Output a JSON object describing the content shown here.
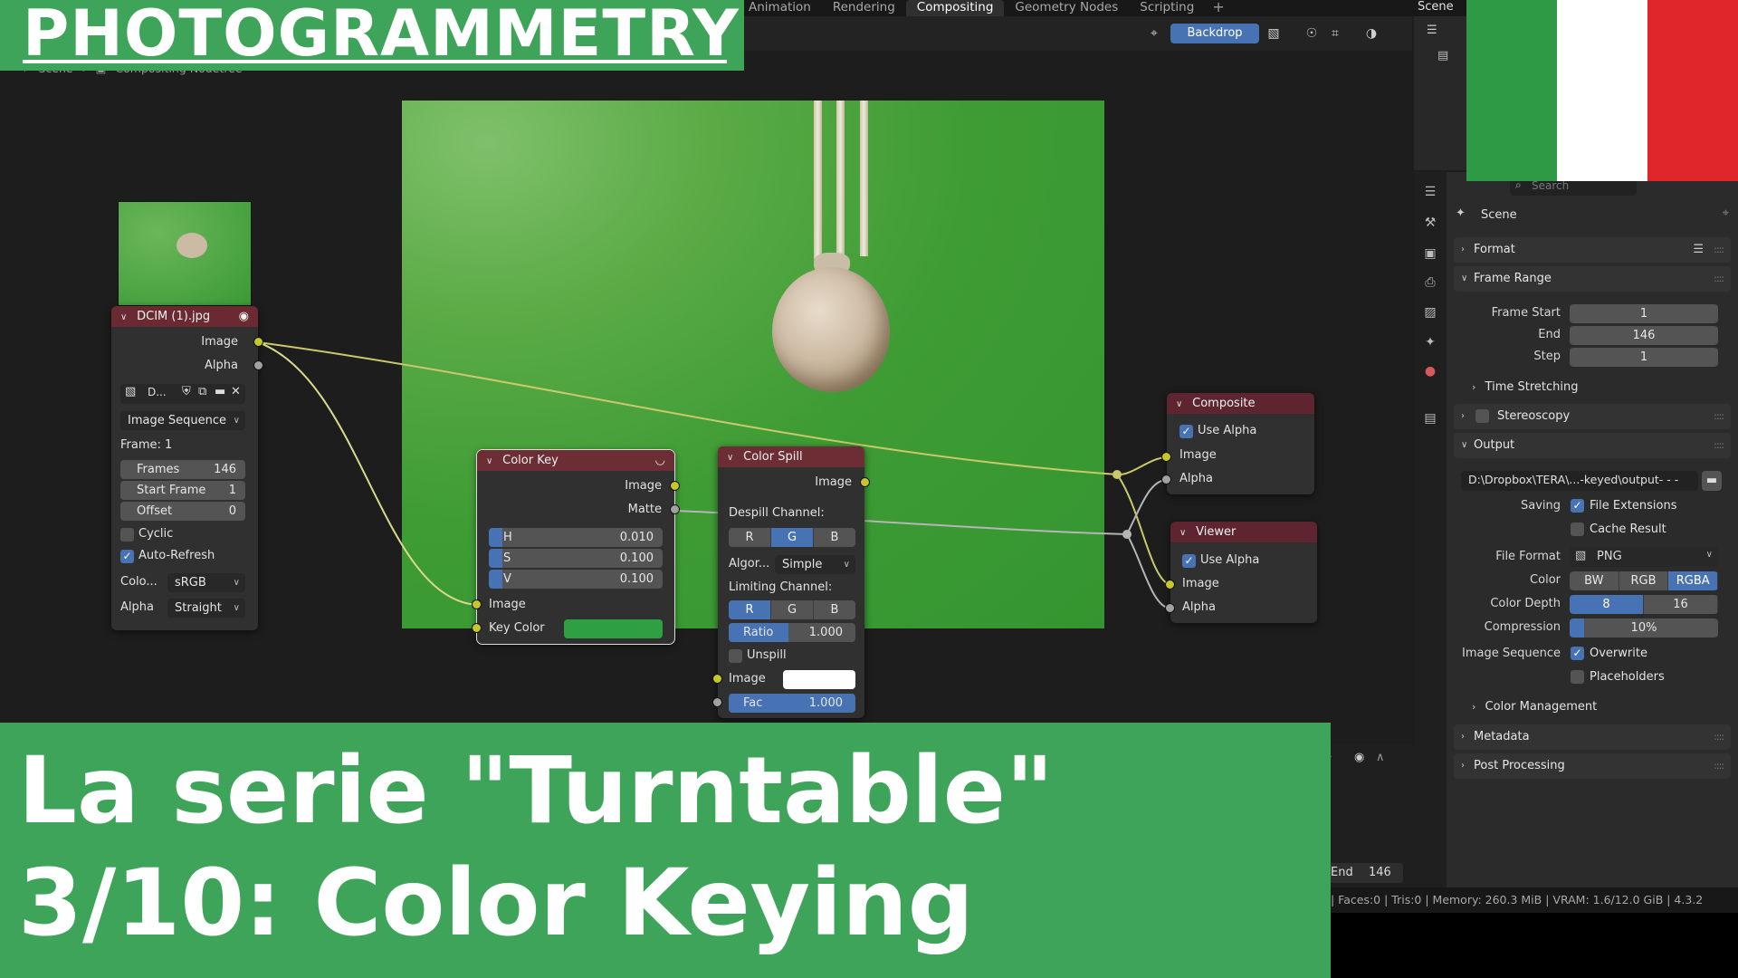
{
  "title_banner": "PHOTOGRAMMETRY",
  "workspace_tabs": [
    "Animation",
    "Rendering",
    "Compositing",
    "Geometry Nodes",
    "Scripting"
  ],
  "active_tab": "Compositing",
  "top_scene_label": "Scene",
  "breadcrumb": {
    "scene": "Scene",
    "tree": "Compositing Nodetree"
  },
  "header": {
    "backdrop": "Backdrop"
  },
  "nodes": {
    "image": {
      "title": "DCIM (1).jpg",
      "out_image": "Image",
      "out_alpha": "Alpha",
      "file_short": "D...",
      "source": "Image Sequence",
      "frame": "Frame: 1",
      "frames_label": "Frames",
      "frames_value": "146",
      "start_label": "Start Frame",
      "start_value": "1",
      "offset_label": "Offset",
      "offset_value": "0",
      "cyclic": "Cyclic",
      "auto_refresh": "Auto-Refresh",
      "color_label": "Colo...",
      "color_value": "sRGB",
      "alpha_label": "Alpha",
      "alpha_value": "Straight"
    },
    "color_key": {
      "title": "Color Key",
      "out_image": "Image",
      "out_matte": "Matte",
      "h_label": "H",
      "h_value": "0.010",
      "s_label": "S",
      "s_value": "0.100",
      "v_label": "V",
      "v_value": "0.100",
      "in_image": "Image",
      "in_key": "Key Color",
      "key_color": "#2ea043"
    },
    "color_spill": {
      "title": "Color Spill",
      "out_image": "Image",
      "despill": "Despill Channel:",
      "despill_r": "R",
      "despill_g": "G",
      "despill_b": "B",
      "algo_label": "Algor...",
      "algo_value": "Simple",
      "limit": "Limiting Channel:",
      "limit_r": "R",
      "limit_g": "G",
      "limit_b": "B",
      "ratio_label": "Ratio",
      "ratio_value": "1.000",
      "unspill": "Unspill",
      "in_image": "Image",
      "fac_label": "Fac",
      "fac_value": "1.000"
    },
    "composite": {
      "title": "Composite",
      "use_alpha": "Use Alpha",
      "in_image": "Image",
      "in_alpha": "Alpha"
    },
    "viewer": {
      "title": "Viewer",
      "use_alpha": "Use Alpha",
      "in_image": "Image",
      "in_alpha": "Alpha"
    }
  },
  "properties": {
    "search_placeholder": "Search",
    "scene": "Scene",
    "format": "Format",
    "frame_range": "Frame Range",
    "frame_start_label": "Frame Start",
    "frame_start": "1",
    "end_label": "End",
    "end": "146",
    "step_label": "Step",
    "step": "1",
    "time_stretching": "Time Stretching",
    "stereoscopy": "Stereoscopy",
    "output": "Output",
    "output_path": "D:\\Dropbox\\TERA\\...-keyed\\output- - -",
    "saving_label": "Saving",
    "file_extensions": "File Extensions",
    "cache_result": "Cache Result",
    "file_format_label": "File Format",
    "file_format": "PNG",
    "color_label": "Color",
    "color_bw": "BW",
    "color_rgb": "RGB",
    "color_rgba": "RGBA",
    "color_depth_label": "Color Depth",
    "depth_8": "8",
    "depth_16": "16",
    "compression_label": "Compression",
    "compression": "10%",
    "compression_fraction": 0.1,
    "image_sequence_label": "Image Sequence",
    "overwrite": "Overwrite",
    "placeholders": "Placeholders",
    "color_management": "Color Management",
    "metadata": "Metadata",
    "post_processing": "Post Processing"
  },
  "timeline": {
    "end_label": "End",
    "end_value": "146"
  },
  "status_bar": "| Faces:0 | Tris:0 | Memory: 260.3 MiB | VRAM: 1.6/12.0 GiB | 4.3.2",
  "bottom_banner": {
    "line1": "La serie \"Turntable\"",
    "line2": "3/10: Color Keying"
  },
  "flag_colors": [
    "#2e9a45",
    "#ffffff",
    "#e0262b"
  ],
  "accent_color": "#4772b3",
  "banner_color": "#3ea45a"
}
